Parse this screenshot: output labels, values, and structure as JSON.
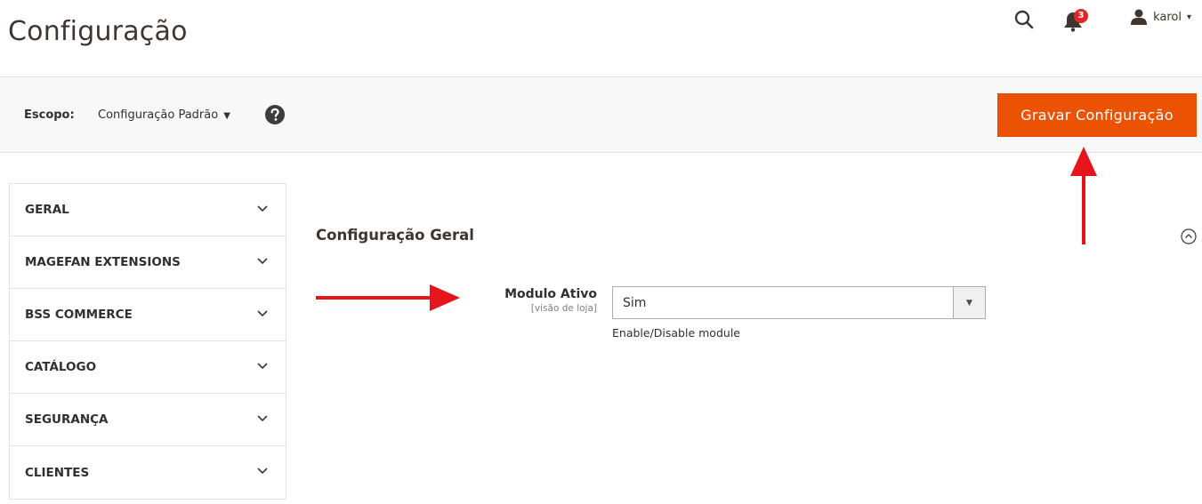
{
  "header": {
    "title": "Configuração",
    "notifications_count": "3",
    "user_name": "karol",
    "user_caret": "▾"
  },
  "scope_bar": {
    "label": "Escopo:",
    "selected": "Configuração Padrão",
    "save_label": "Gravar Configuração"
  },
  "sidebar": {
    "items": [
      {
        "label": "GERAL"
      },
      {
        "label": "MAGEFAN EXTENSIONS"
      },
      {
        "label": "BSS COMMERCE"
      },
      {
        "label": "CATÁLOGO"
      },
      {
        "label": "SEGURANÇA"
      },
      {
        "label": "CLIENTES"
      }
    ]
  },
  "section": {
    "title": "Configuração Geral",
    "field_label": "Modulo Ativo",
    "field_scope": "[visão de loja]",
    "field_value": "Sim",
    "field_note": "Enable/Disable module"
  },
  "colors": {
    "accent": "#eb5202",
    "annotation_arrow": "#e8141c",
    "badge": "#e22626"
  }
}
